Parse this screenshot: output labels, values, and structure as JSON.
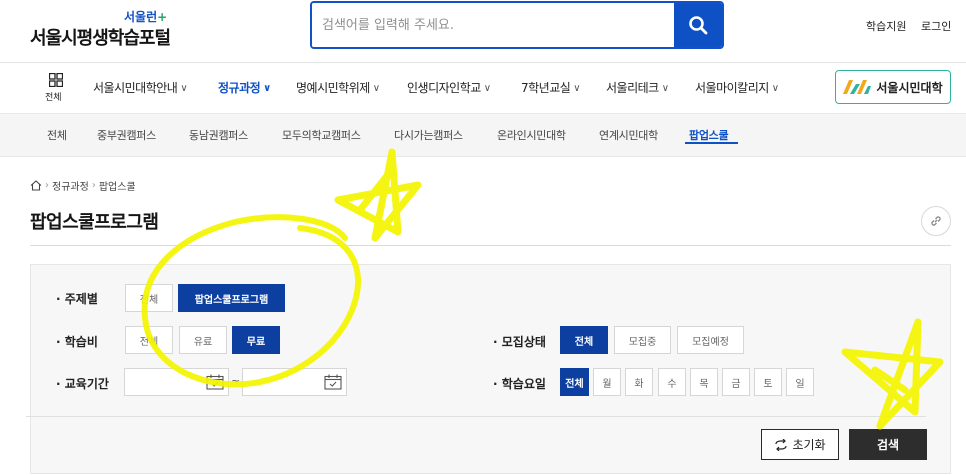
{
  "header": {
    "logo_badge": "서울런",
    "logo_plus": "+",
    "logo_title": "서울시평생학습포털",
    "search_placeholder": "검색어를 입력해 주세요.",
    "util_support": "학습지원",
    "util_login": "로그인"
  },
  "gnb": {
    "all_label": "전체",
    "items": [
      {
        "label": "서울시민대학안내"
      },
      {
        "label": "정규과정"
      },
      {
        "label": "명예시민학위제"
      },
      {
        "label": "인생디자인학교"
      },
      {
        "label": "7학년교실"
      },
      {
        "label": "서울리테크"
      },
      {
        "label": "서울마이칼리지"
      }
    ],
    "active_index": 1,
    "univ_label": "서울시민대학"
  },
  "subnav": {
    "items": [
      "전체",
      "중부권캠퍼스",
      "동남권캠퍼스",
      "모두의학교캠퍼스",
      "다시가는캠퍼스",
      "온라인시민대학",
      "연계시민대학",
      "팝업스쿨"
    ],
    "active_index": 7
  },
  "breadcrumb": {
    "items": [
      "정규과정",
      "팝업스쿨"
    ]
  },
  "page_title": "팝업스쿨프로그램",
  "filter": {
    "topic": {
      "label": "· 주제별",
      "options": [
        "전체",
        "팝업스쿨프로그램"
      ],
      "selected": "팝업스쿨프로그램"
    },
    "fee": {
      "label": "· 학습비",
      "options": [
        "전체",
        "유료",
        "무료"
      ],
      "selected": "무료"
    },
    "period": {
      "label": "· 교육기간",
      "start": "",
      "end": "",
      "separator": "~"
    },
    "recruit": {
      "label": "· 모집상태",
      "options": [
        "전체",
        "모집중",
        "모집예정"
      ],
      "selected": "전체"
    },
    "day": {
      "label": "· 학습요일",
      "options": [
        "전체",
        "월",
        "화",
        "수",
        "목",
        "금",
        "토",
        "일"
      ],
      "selected": "전체"
    },
    "reset_label": "초기화",
    "search_label": "검색"
  },
  "colors": {
    "primary": "#0d51c5",
    "selected_chip": "#0d3fa0",
    "marker": "#f2f200"
  }
}
